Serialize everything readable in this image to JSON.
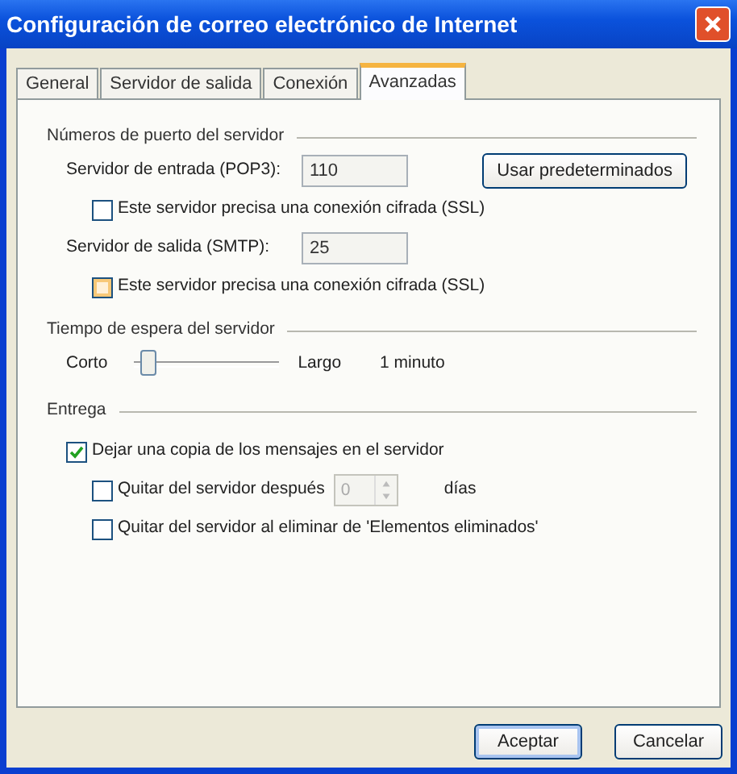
{
  "window": {
    "title": "Configuración de correo electrónico de Internet"
  },
  "tabs": [
    {
      "label": "General",
      "selected": false
    },
    {
      "label": "Servidor de salida",
      "selected": false
    },
    {
      "label": "Conexión",
      "selected": false
    },
    {
      "label": "Avanzadas",
      "selected": true
    }
  ],
  "ports": {
    "heading": "Números de puerto del servidor",
    "defaults_button": "Usar predeterminados",
    "rows": [
      {
        "kind": "field",
        "label": "Servidor de entrada (POP3):",
        "value": "110"
      },
      {
        "kind": "checkbox",
        "label": "Este servidor precisa una conexión cifrada (SSL)",
        "checked": false,
        "highlighted": false
      },
      {
        "kind": "field",
        "label": "Servidor de salida (SMTP):",
        "value": "25"
      },
      {
        "kind": "checkbox",
        "label": "Este servidor precisa una conexión cifrada (SSL)",
        "checked": false,
        "highlighted": true
      }
    ]
  },
  "timeout": {
    "heading": "Tiempo de espera del servidor",
    "min_label": "Corto",
    "max_label": "Largo",
    "level": 0.1,
    "reading": "1 minuto"
  },
  "delivery": {
    "heading": "Entrega",
    "options": [
      {
        "label": "Dejar una copia de los mensajes en el servidor",
        "checked": true,
        "children": [
          {
            "kind": "spin",
            "label": "Quitar del servidor después",
            "checked": false,
            "disabled": true,
            "value": "0",
            "unit": "días"
          },
          {
            "kind": "checkbox",
            "label": "Quitar del servidor al eliminar de 'Elementos eliminados'",
            "checked": false
          }
        ]
      }
    ]
  },
  "buttons": [
    {
      "label": "Aceptar",
      "default": true
    },
    {
      "label": "Cancelar",
      "default": false
    }
  ]
}
